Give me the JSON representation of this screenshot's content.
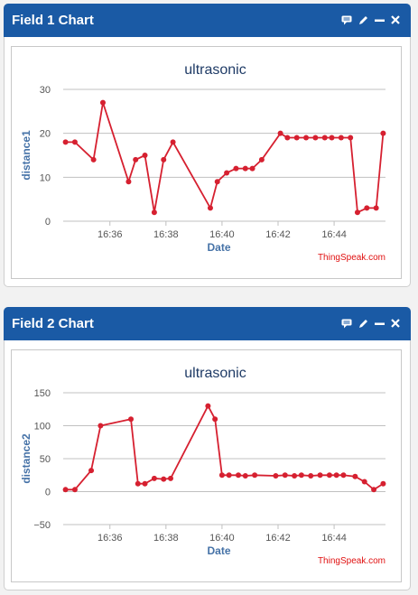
{
  "panels": [
    {
      "header": {
        "title": "Field 1 Chart"
      },
      "icons": [
        "comment-icon",
        "edit-icon",
        "minimize-icon",
        "close-icon"
      ],
      "credit": "ThingSpeak.com"
    },
    {
      "header": {
        "title": "Field 2 Chart"
      },
      "icons": [
        "comment-icon",
        "edit-icon",
        "minimize-icon",
        "close-icon"
      ],
      "credit": "ThingSpeak.com"
    }
  ],
  "colors": {
    "header": "#1a5aa5",
    "line": "#d62030",
    "title": "#1f3b66",
    "axis_label": "#4572a7",
    "credit": "#e01010"
  },
  "chart_data": [
    {
      "type": "line",
      "title": "ultrasonic",
      "xlabel": "Date",
      "ylabel": "distance1",
      "ylim": [
        0,
        30
      ],
      "yticks": [
        "0",
        "10",
        "20",
        "30"
      ],
      "xticks": [
        "16:36",
        "16:38",
        "16:40",
        "16:42",
        "16:44"
      ],
      "xlim": [
        "16:34:20",
        "16:45:50"
      ],
      "series": [
        {
          "points": [
            [
              "16:34:25",
              18
            ],
            [
              "16:34:45",
              18
            ],
            [
              "16:35:25",
              14
            ],
            [
              "16:35:45",
              27
            ],
            [
              "16:36:40",
              9
            ],
            [
              "16:36:55",
              14
            ],
            [
              "16:37:15",
              15
            ],
            [
              "16:37:35",
              2
            ],
            [
              "16:37:55",
              14
            ],
            [
              "16:38:15",
              18
            ],
            [
              "16:39:35",
              3
            ],
            [
              "16:39:50",
              9
            ],
            [
              "16:40:10",
              11
            ],
            [
              "16:40:30",
              12
            ],
            [
              "16:40:50",
              12
            ],
            [
              "16:41:05",
              12
            ],
            [
              "16:41:25",
              14
            ],
            [
              "16:42:05",
              20
            ],
            [
              "16:42:20",
              19
            ],
            [
              "16:42:40",
              19
            ],
            [
              "16:43:00",
              19
            ],
            [
              "16:43:20",
              19
            ],
            [
              "16:43:40",
              19
            ],
            [
              "16:43:55",
              19
            ],
            [
              "16:44:15",
              19
            ],
            [
              "16:44:35",
              19
            ],
            [
              "16:44:50",
              2
            ],
            [
              "16:45:10",
              3
            ],
            [
              "16:45:30",
              3
            ],
            [
              "16:45:45",
              20
            ]
          ]
        }
      ]
    },
    {
      "type": "line",
      "title": "ultrasonic",
      "xlabel": "Date",
      "ylabel": "distance2",
      "ylim": [
        -50,
        150
      ],
      "yticks": [
        "−50",
        "0",
        "50",
        "100",
        "150"
      ],
      "xticks": [
        "16:36",
        "16:38",
        "16:40",
        "16:42",
        "16:44"
      ],
      "xlim": [
        "16:34:20",
        "16:45:50"
      ],
      "series": [
        {
          "points": [
            [
              "16:34:25",
              3
            ],
            [
              "16:34:45",
              3
            ],
            [
              "16:35:20",
              32
            ],
            [
              "16:35:40",
              100
            ],
            [
              "16:36:45",
              110
            ],
            [
              "16:37:00",
              12
            ],
            [
              "16:37:15",
              12
            ],
            [
              "16:37:35",
              20
            ],
            [
              "16:37:55",
              19
            ],
            [
              "16:38:10",
              20
            ],
            [
              "16:39:30",
              130
            ],
            [
              "16:39:45",
              110
            ],
            [
              "16:40:00",
              25
            ],
            [
              "16:40:15",
              25
            ],
            [
              "16:40:35",
              25
            ],
            [
              "16:40:50",
              24
            ],
            [
              "16:41:10",
              25
            ],
            [
              "16:41:55",
              24
            ],
            [
              "16:42:15",
              25
            ],
            [
              "16:42:35",
              24
            ],
            [
              "16:42:50",
              25
            ],
            [
              "16:43:10",
              24
            ],
            [
              "16:43:30",
              25
            ],
            [
              "16:43:50",
              25
            ],
            [
              "16:44:05",
              25
            ],
            [
              "16:44:20",
              25
            ],
            [
              "16:44:45",
              23
            ],
            [
              "16:45:05",
              15
            ],
            [
              "16:45:25",
              3
            ],
            [
              "16:45:45",
              12
            ]
          ]
        }
      ]
    }
  ]
}
